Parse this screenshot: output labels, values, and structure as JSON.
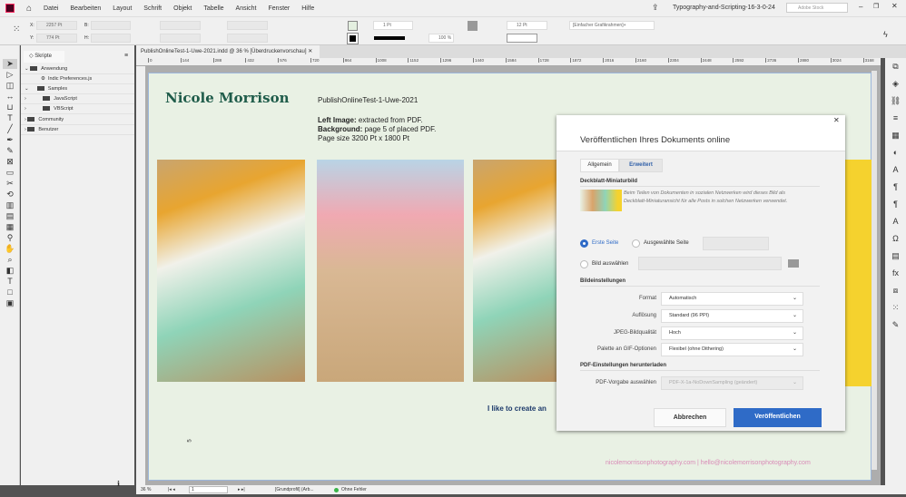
{
  "menu": {
    "items": [
      "Datei",
      "Bearbeiten",
      "Layout",
      "Schrift",
      "Objekt",
      "Tabelle",
      "Ansicht",
      "Fenster",
      "Hilfe"
    ],
    "doc_title": "Typography-and-Scripting-16-3-0-24",
    "stock_placeholder": "Adobe Stock"
  },
  "control": {
    "x_label": "X:",
    "x": "2257 Pt",
    "y_label": "Y:",
    "y": "774 Pt",
    "b_label": "B:",
    "h_label": "H:",
    "stroke": "1 Pt",
    "zoom": "100 %",
    "gap": "12 Pt",
    "frame_style": "[Einfacher Grafikrahmen]+"
  },
  "panel": {
    "title": "Skripte",
    "items": [
      {
        "label": "Anwendung"
      },
      {
        "label": "Indic Preferences.js"
      },
      {
        "label": "Samples"
      },
      {
        "label": "JavaScript"
      },
      {
        "label": "VBScript"
      },
      {
        "label": "Community"
      },
      {
        "label": "Benutzer"
      }
    ]
  },
  "document": {
    "tab": "PublishOnlineTest-1-Uwe-2021.indd @ 36 % [Überdruckenvorschau]",
    "ruler_ticks": [
      "0",
      "144",
      "288",
      "432",
      "576",
      "720",
      "864",
      "1008",
      "1152",
      "1296",
      "1440",
      "1584",
      "1728",
      "1872",
      "2016",
      "2160",
      "2304",
      "2448",
      "2592",
      "2736",
      "2880",
      "3024",
      "3168"
    ]
  },
  "page": {
    "name": "Nicole Morrison",
    "heading": "PublishOnlineTest-1-Uwe-2021",
    "left_label": "Left Image:",
    "left_text": " extracted from PDF.",
    "bg_label": "Background:",
    "bg_text": " page 5 of placed PDF.",
    "size": "Page size 3200 Pt x 1800 Pt",
    "tagline": "I like to create an",
    "footer": "nicolemorrisonphotography.com | hello@nicolemorrisonphotography.com",
    "page_num": "5"
  },
  "dialog": {
    "title": "Veröffentlichen Ihres Dokuments online",
    "tabs": [
      "Allgemein",
      "Erweitert"
    ],
    "cover_section": "Deckblatt-Miniaturbild",
    "cover_desc": "Beim Teilen von Dokumenten in sozialen Netzwerken wird dieses Bild als Deckblatt-Miniaturansicht für alle Posts in solchen Netzwerken verwendet.",
    "radio_first": "Erste Seite",
    "radio_selected": "Ausgewählte Seite",
    "radio_image": "Bild auswählen",
    "image_section": "Bildeinstellungen",
    "fields": [
      {
        "label": "Format",
        "value": "Automatisch"
      },
      {
        "label": "Auflösung",
        "value": "Standard (96 PPI)"
      },
      {
        "label": "JPEG-Bildqualität",
        "value": "Hoch"
      },
      {
        "label": "Palette an GIF-Optionen",
        "value": "Flexibel (ohne Dithering)"
      }
    ],
    "pdf_section": "PDF-Einstellungen herunterladen",
    "pdf_label": "PDF-Vorgabe auswählen",
    "pdf_value": "PDF-X-1a-NoDownSampling (geändert)",
    "cancel": "Abbrechen",
    "publish": "Veröffentlichen"
  },
  "status": {
    "zoom": "36 %",
    "page": "1",
    "profile": "[Grundprofil] (Arb...",
    "errors": "Ohne Fehler"
  },
  "colors": {
    "accent": "#2f6bc7",
    "name": "#1f5c4a",
    "footer": "#d98bb7",
    "page_bg": "#e9f1e4"
  }
}
